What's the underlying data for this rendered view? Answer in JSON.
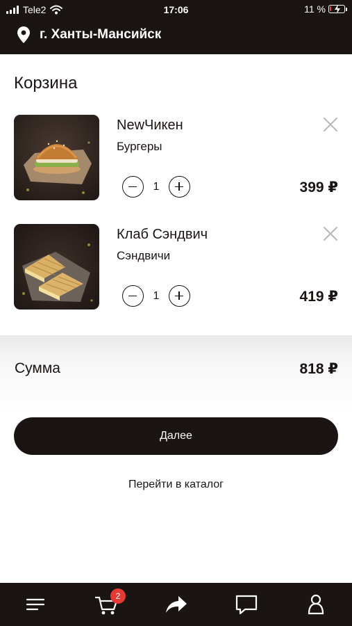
{
  "status_bar": {
    "carrier": "Tele2",
    "time": "17:06",
    "battery_percent": "11 %",
    "battery_level": 0.11
  },
  "header": {
    "city": "г. Ханты-Мансийск",
    "icon": "location-pin-icon"
  },
  "cart": {
    "title": "Корзина",
    "items": [
      {
        "name": "NewЧикен",
        "category": "Бургеры",
        "quantity": "1",
        "price": "399 ₽",
        "image": "burger"
      },
      {
        "name": "Клаб Сэндвич",
        "category": "Сэндвичи",
        "quantity": "1",
        "price": "419 ₽",
        "image": "sandwich"
      }
    ],
    "sum_label": "Сумма",
    "sum_value": "818 ₽"
  },
  "actions": {
    "next_label": "Далее",
    "catalog_label": "Перейти в каталог"
  },
  "tabbar": {
    "cart_badge": "2",
    "tabs": [
      "menu-icon",
      "cart-icon",
      "share-icon",
      "chat-icon",
      "profile-icon"
    ]
  },
  "colors": {
    "dark": "#1a1412",
    "badge": "#e53935",
    "battery_low": "#e3473b"
  }
}
